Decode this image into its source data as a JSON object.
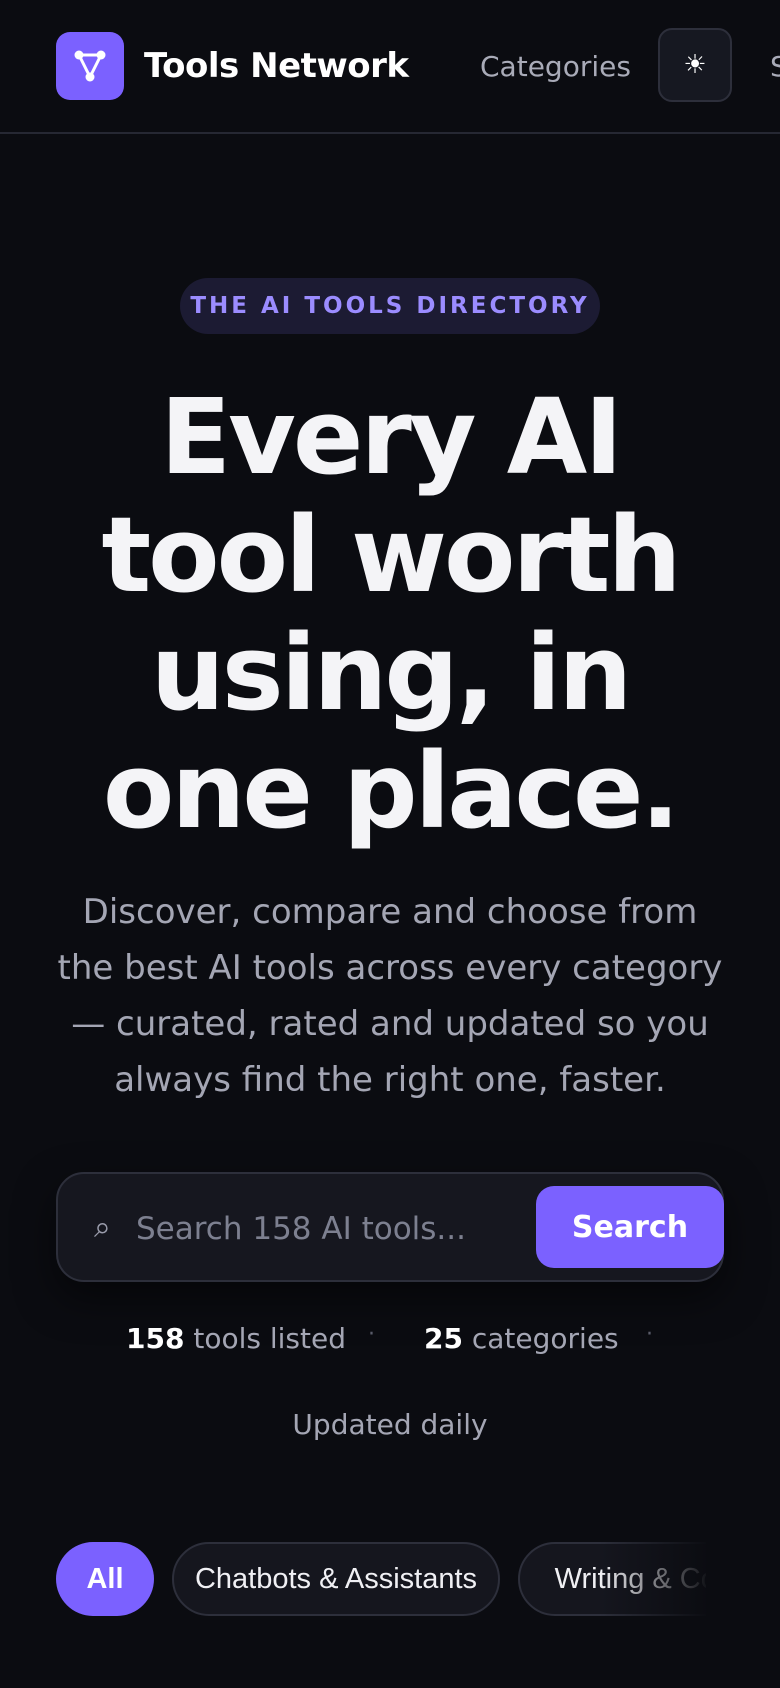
{
  "header": {
    "brand": "Tools Network",
    "logo_icon": "network-nodes-icon",
    "nav": {
      "categories": "Categories",
      "next_partial": "S"
    },
    "theme_toggle": "sun-icon"
  },
  "hero": {
    "badge": "THE AI TOOLS DIRECTORY",
    "title": "Every AI tool worth using, in one place.",
    "subtitle": "Discover, compare and choose from the best AI tools across every category — curated, rated and updated so you always find the right one, faster."
  },
  "search": {
    "placeholder": "Search 158 AI tools...",
    "value": "",
    "button": "Search",
    "icon": "search-icon"
  },
  "stats": {
    "tools_count": "158",
    "tools_label": "tools listed",
    "categories_count": "25",
    "categories_label": "categories",
    "updated": "Updated daily"
  },
  "chips": [
    {
      "label": "All",
      "active": true
    },
    {
      "label": "Chatbots & Assistants",
      "active": false
    },
    {
      "label": "Writing & Content",
      "active": false
    }
  ],
  "colors": {
    "background": "#0b0c11",
    "accent": "#7b61ff",
    "badge_text": "#9b8cff",
    "muted_text": "#a4a6b4"
  }
}
